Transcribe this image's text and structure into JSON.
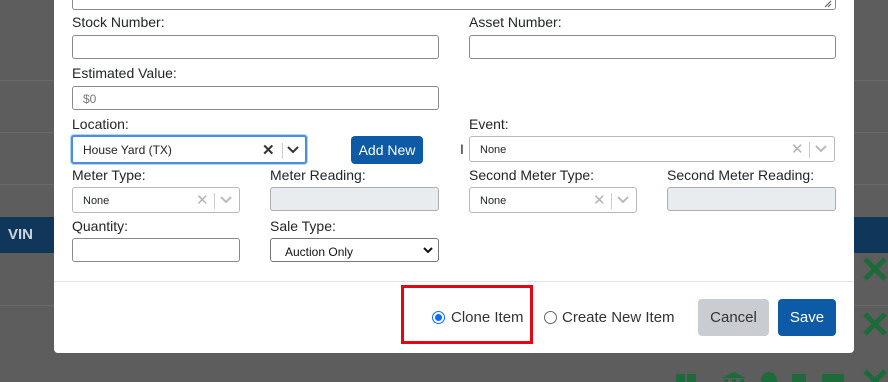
{
  "background": {
    "table_header": "VIN"
  },
  "form": {
    "stock_number": {
      "label": "Stock Number:",
      "value": ""
    },
    "asset_number": {
      "label": "Asset Number:",
      "value": ""
    },
    "estimated_value": {
      "label": "Estimated Value:",
      "placeholder": "$0"
    },
    "location": {
      "label": "Location:",
      "value": "House Yard (TX)"
    },
    "add_new_label": "Add New",
    "event": {
      "label": "Event:",
      "value": "None"
    },
    "meter_type": {
      "label": "Meter Type:",
      "value": "None"
    },
    "meter_reading": {
      "label": "Meter Reading:",
      "value": ""
    },
    "second_meter_type": {
      "label": "Second Meter Type:",
      "value": "None"
    },
    "second_meter_reading": {
      "label": "Second Meter Reading:",
      "value": ""
    },
    "quantity": {
      "label": "Quantity:",
      "value": ""
    },
    "sale_type": {
      "label": "Sale Type:",
      "value": "Auction Only"
    }
  },
  "footer": {
    "clone_item_label": "Clone Item",
    "create_new_item_label": "Create New Item",
    "cancel_label": "Cancel",
    "save_label": "Save",
    "selected_mode": "clone"
  },
  "colors": {
    "primary": "#0d5aa7",
    "highlight": "#e30613",
    "focus": "#4a90d9"
  }
}
